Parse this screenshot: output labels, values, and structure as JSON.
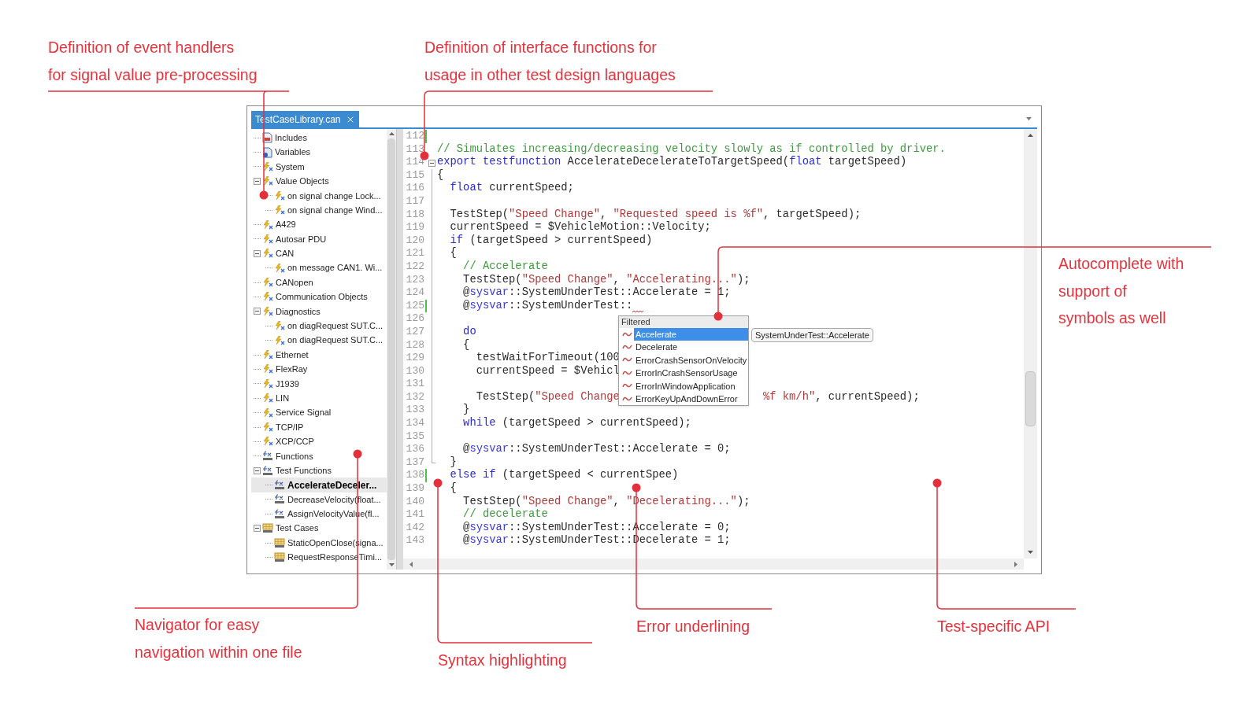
{
  "annotations": [
    {
      "text": [
        "Definition of event handlers",
        "for signal value pre-processing"
      ]
    },
    {
      "text": [
        "Definition of interface functions for",
        "usage in other test design languages"
      ]
    },
    {
      "text": [
        "Autocomplete with",
        "support of",
        "symbols as well"
      ]
    },
    {
      "text": [
        "Navigator for easy",
        "navigation within one file"
      ]
    },
    {
      "text": [
        "Syntax highlighting"
      ]
    },
    {
      "text": [
        "Error underlining"
      ]
    },
    {
      "text": [
        "Test-specific API"
      ]
    }
  ],
  "tab": {
    "label": "TestCaseLibrary.can",
    "selected": true
  },
  "navigator": {
    "items": [
      {
        "label": "Includes",
        "kind": "include",
        "expanded": false,
        "selected": false
      },
      {
        "label": "Variables",
        "kind": "variables",
        "expanded": false,
        "selected": false
      },
      {
        "label": "System",
        "kind": "event",
        "expanded": false,
        "selected": false
      },
      {
        "label": "Value Objects",
        "kind": "event",
        "expanded": true,
        "selected": false,
        "children": [
          {
            "label": "on signal change Lock...",
            "kind": "event",
            "expanded": false,
            "selected": false
          },
          {
            "label": "on signal change Wind...",
            "kind": "event",
            "expanded": false,
            "selected": false
          }
        ]
      },
      {
        "label": "A429",
        "kind": "event",
        "expanded": false,
        "selected": false
      },
      {
        "label": "Autosar PDU",
        "kind": "event",
        "expanded": false,
        "selected": false
      },
      {
        "label": "CAN",
        "kind": "event",
        "expanded": true,
        "selected": false,
        "children": [
          {
            "label": "on message CAN1. Wi...",
            "kind": "event",
            "expanded": false,
            "selected": false
          }
        ]
      },
      {
        "label": "CANopen",
        "kind": "event",
        "expanded": false,
        "selected": false
      },
      {
        "label": "Communication Objects",
        "kind": "event",
        "expanded": false,
        "selected": false
      },
      {
        "label": "Diagnostics",
        "kind": "event",
        "expanded": true,
        "selected": false,
        "children": [
          {
            "label": "on diagRequest SUT.C...",
            "kind": "event",
            "expanded": false,
            "selected": false
          },
          {
            "label": "on diagRequest SUT.C...",
            "kind": "event",
            "expanded": false,
            "selected": false
          }
        ]
      },
      {
        "label": "Ethernet",
        "kind": "event",
        "expanded": false,
        "selected": false
      },
      {
        "label": "FlexRay",
        "kind": "event",
        "expanded": false,
        "selected": false
      },
      {
        "label": "J1939",
        "kind": "event",
        "expanded": false,
        "selected": false
      },
      {
        "label": "LIN",
        "kind": "event",
        "expanded": false,
        "selected": false
      },
      {
        "label": "Service Signal",
        "kind": "event",
        "expanded": false,
        "selected": false
      },
      {
        "label": "TCP/IP",
        "kind": "event",
        "expanded": false,
        "selected": false
      },
      {
        "label": "XCP/CCP",
        "kind": "event",
        "expanded": false,
        "selected": false
      },
      {
        "label": "Functions",
        "kind": "function",
        "expanded": false,
        "selected": false
      },
      {
        "label": "Test Functions",
        "kind": "function",
        "expanded": true,
        "selected": false,
        "children": [
          {
            "label": "AccelerateDeceler...",
            "kind": "function",
            "expanded": false,
            "selected": true
          },
          {
            "label": "DecreaseVelocity(float...",
            "kind": "function",
            "expanded": false,
            "selected": false
          },
          {
            "label": "AssignVelocityValue(fl...",
            "kind": "function",
            "expanded": false,
            "selected": false
          }
        ]
      },
      {
        "label": "Test Cases",
        "kind": "testcase",
        "expanded": true,
        "selected": false,
        "children": [
          {
            "label": "StaticOpenClose(signa...",
            "kind": "testcase",
            "expanded": false,
            "selected": false
          },
          {
            "label": "RequestResponseTimi...",
            "kind": "testcase",
            "expanded": false,
            "selected": false
          }
        ]
      }
    ]
  },
  "editor": {
    "lines": [
      {
        "number": "112",
        "modified": true,
        "fold_start": false,
        "fold_end": false,
        "error": false
      },
      {
        "number": "113",
        "modified": false,
        "fold_start": false,
        "fold_end": false,
        "error": false,
        "tokens": [
          {
            "kind": "comment",
            "text": "// Simulates increasing/decreasing velocity slowly as if controlled by driver."
          }
        ]
      },
      {
        "number": "114",
        "modified": false,
        "fold_start": true,
        "fold_end": false,
        "error": false,
        "tokens": [
          {
            "kind": "keyword",
            "text": "export"
          },
          {
            "kind": "keyword",
            "text": " testfunction"
          },
          {
            "kind": "plain",
            "text": " AccelerateDecelerateToTargetSpeed("
          },
          {
            "kind": "keyword",
            "text": "float"
          },
          {
            "kind": "plain",
            "text": " targetSpeed)"
          }
        ]
      },
      {
        "number": "115",
        "modified": false,
        "fold_start": false,
        "fold_end": false,
        "error": false,
        "tokens": [
          {
            "kind": "plain",
            "text": "{"
          }
        ]
      },
      {
        "number": "116",
        "modified": false,
        "fold_start": false,
        "fold_end": false,
        "error": false,
        "tokens": [
          {
            "kind": "keyword",
            "text": "  float"
          },
          {
            "kind": "plain",
            "text": " currentSpeed;"
          }
        ]
      },
      {
        "number": "117",
        "modified": false,
        "fold_start": false,
        "fold_end": false,
        "error": false
      },
      {
        "number": "118",
        "modified": false,
        "fold_start": false,
        "fold_end": false,
        "error": false,
        "tokens": [
          {
            "kind": "plain",
            "text": "  TestStep("
          },
          {
            "kind": "string",
            "text": "\"Speed Change\""
          },
          {
            "kind": "plain",
            "text": ", "
          },
          {
            "kind": "string",
            "text": "\"Requested speed is %f\""
          },
          {
            "kind": "plain",
            "text": ", targetSpeed);"
          }
        ]
      },
      {
        "number": "119",
        "modified": false,
        "fold_start": false,
        "fold_end": false,
        "error": false,
        "tokens": [
          {
            "kind": "plain",
            "text": "  currentSpeed = $VehicleMotion::Velocity;"
          }
        ]
      },
      {
        "number": "120",
        "modified": false,
        "fold_start": false,
        "fold_end": false,
        "error": false,
        "tokens": [
          {
            "kind": "keyword",
            "text": "  if"
          },
          {
            "kind": "plain",
            "text": " (targetSpeed > currentSpeed)"
          }
        ]
      },
      {
        "number": "121",
        "modified": false,
        "fold_start": false,
        "fold_end": false,
        "error": false,
        "tokens": [
          {
            "kind": "plain",
            "text": "  {"
          }
        ]
      },
      {
        "number": "122",
        "modified": false,
        "fold_start": false,
        "fold_end": false,
        "error": false,
        "tokens": [
          {
            "kind": "comment",
            "text": "    // Accelerate"
          }
        ]
      },
      {
        "number": "123",
        "modified": false,
        "fold_start": false,
        "fold_end": false,
        "error": false,
        "tokens": [
          {
            "kind": "plain",
            "text": "    TestStep("
          },
          {
            "kind": "string",
            "text": "\"Speed Change\""
          },
          {
            "kind": "plain",
            "text": ", "
          },
          {
            "kind": "string",
            "text": "\"Accelerating...\""
          },
          {
            "kind": "plain",
            "text": ");"
          }
        ]
      },
      {
        "number": "124",
        "modified": false,
        "fold_start": false,
        "fold_end": false,
        "error": false,
        "tokens": [
          {
            "kind": "plain",
            "text": "    @"
          },
          {
            "kind": "sysvar",
            "text": "sysvar"
          },
          {
            "kind": "plain",
            "text": "::SystemUnderTest::Accelerate = 1;"
          }
        ]
      },
      {
        "number": "125",
        "modified": true,
        "fold_start": false,
        "fold_end": false,
        "error": true,
        "tokens": [
          {
            "kind": "plain",
            "text": "    @"
          },
          {
            "kind": "sysvar",
            "text": "sysvar"
          },
          {
            "kind": "plain",
            "text": "::SystemUnderTest::"
          }
        ]
      },
      {
        "number": "126",
        "modified": false,
        "fold_start": false,
        "fold_end": false,
        "error": false
      },
      {
        "number": "127",
        "modified": false,
        "fold_start": false,
        "fold_end": false,
        "error": false,
        "tokens": [
          {
            "kind": "keyword",
            "text": "    do"
          }
        ]
      },
      {
        "number": "128",
        "modified": false,
        "fold_start": false,
        "fold_end": false,
        "error": false,
        "tokens": [
          {
            "kind": "plain",
            "text": "    {"
          }
        ]
      },
      {
        "number": "129",
        "modified": false,
        "fold_start": false,
        "fold_end": false,
        "error": false,
        "tokens": [
          {
            "kind": "plain",
            "text": "      testWaitForTimeout(100"
          }
        ]
      },
      {
        "number": "130",
        "modified": false,
        "fold_start": false,
        "fold_end": false,
        "error": false,
        "tokens": [
          {
            "kind": "plain",
            "text": "      currentSpeed = $Vehicl"
          }
        ]
      },
      {
        "number": "131",
        "modified": false,
        "fold_start": false,
        "fold_end": false,
        "error": false
      },
      {
        "number": "132",
        "modified": false,
        "fold_start": false,
        "fold_end": false,
        "error": false,
        "tokens": [
          {
            "kind": "plain",
            "text": "      TestStep("
          },
          {
            "kind": "string",
            "text": "\"Speed Change"
          },
          {
            "kind": "resume_string",
            "text": "%f km/h\""
          },
          {
            "kind": "resume",
            "text": ", currentSpeed);"
          }
        ]
      },
      {
        "number": "133",
        "modified": false,
        "fold_start": false,
        "fold_end": false,
        "error": false,
        "tokens": [
          {
            "kind": "plain",
            "text": "    }"
          }
        ]
      },
      {
        "number": "134",
        "modified": false,
        "fold_start": false,
        "fold_end": false,
        "error": false,
        "tokens": [
          {
            "kind": "keyword",
            "text": "    while"
          },
          {
            "kind": "plain",
            "text": " (targetSpeed > currentSpeed);"
          }
        ]
      },
      {
        "number": "135",
        "modified": false,
        "fold_start": false,
        "fold_end": false,
        "error": false
      },
      {
        "number": "136",
        "modified": false,
        "fold_start": false,
        "fold_end": false,
        "error": false,
        "tokens": [
          {
            "kind": "plain",
            "text": "    @"
          },
          {
            "kind": "sysvar",
            "text": "sysvar"
          },
          {
            "kind": "plain",
            "text": "::SystemUnderTest::Accelerate = 0;"
          }
        ]
      },
      {
        "number": "137",
        "modified": false,
        "fold_start": false,
        "fold_end": true,
        "error": false,
        "tokens": [
          {
            "kind": "plain",
            "text": "  }"
          }
        ]
      },
      {
        "number": "138",
        "modified": true,
        "fold_start": false,
        "fold_end": false,
        "error": false,
        "tokens": [
          {
            "kind": "keyword",
            "text": "  else"
          },
          {
            "kind": "keyword",
            "text": " if"
          },
          {
            "kind": "plain",
            "text": " (targetSpeed < currentSpee)"
          }
        ]
      },
      {
        "number": "139",
        "modified": false,
        "fold_start": false,
        "fold_end": false,
        "error": false,
        "tokens": [
          {
            "kind": "plain",
            "text": "  {"
          }
        ]
      },
      {
        "number": "140",
        "modified": false,
        "fold_start": false,
        "fold_end": false,
        "error": false,
        "tokens": [
          {
            "kind": "plain",
            "text": "    TestStep("
          },
          {
            "kind": "string",
            "text": "\"Speed Change\""
          },
          {
            "kind": "plain",
            "text": ", "
          },
          {
            "kind": "string",
            "text": "\"Decelerating...\""
          },
          {
            "kind": "plain",
            "text": ");"
          }
        ]
      },
      {
        "number": "141",
        "modified": false,
        "fold_start": false,
        "fold_end": false,
        "error": false,
        "tokens": [
          {
            "kind": "comment",
            "text": "    // decelerate"
          }
        ]
      },
      {
        "number": "142",
        "modified": false,
        "fold_start": false,
        "fold_end": false,
        "error": false,
        "tokens": [
          {
            "kind": "plain",
            "text": "    @"
          },
          {
            "kind": "sysvar",
            "text": "sysvar"
          },
          {
            "kind": "plain",
            "text": "::SystemUnderTest::Accelerate = 0;"
          }
        ]
      },
      {
        "number": "143",
        "modified": false,
        "fold_start": false,
        "fold_end": false,
        "error": false,
        "tokens": [
          {
            "kind": "plain",
            "text": "    @"
          },
          {
            "kind": "sysvar",
            "text": "sysvar"
          },
          {
            "kind": "plain",
            "text": "::SystemUnderTest::Decelerate = 1;"
          }
        ]
      }
    ]
  },
  "autocomplete": {
    "header": "Filtered",
    "tooltip": "SystemUnderTest::Accelerate",
    "items": [
      {
        "label": "Accelerate",
        "selected": true
      },
      {
        "label": "Decelerate",
        "selected": false
      },
      {
        "label": "ErrorCrashSensorOnVelocity",
        "selected": false
      },
      {
        "label": "ErrorInCrashSensorUsage",
        "selected": false
      },
      {
        "label": "ErrorInWindowApplication",
        "selected": false
      },
      {
        "label": "ErrorKeyUpAndDownError",
        "selected": false
      }
    ]
  }
}
